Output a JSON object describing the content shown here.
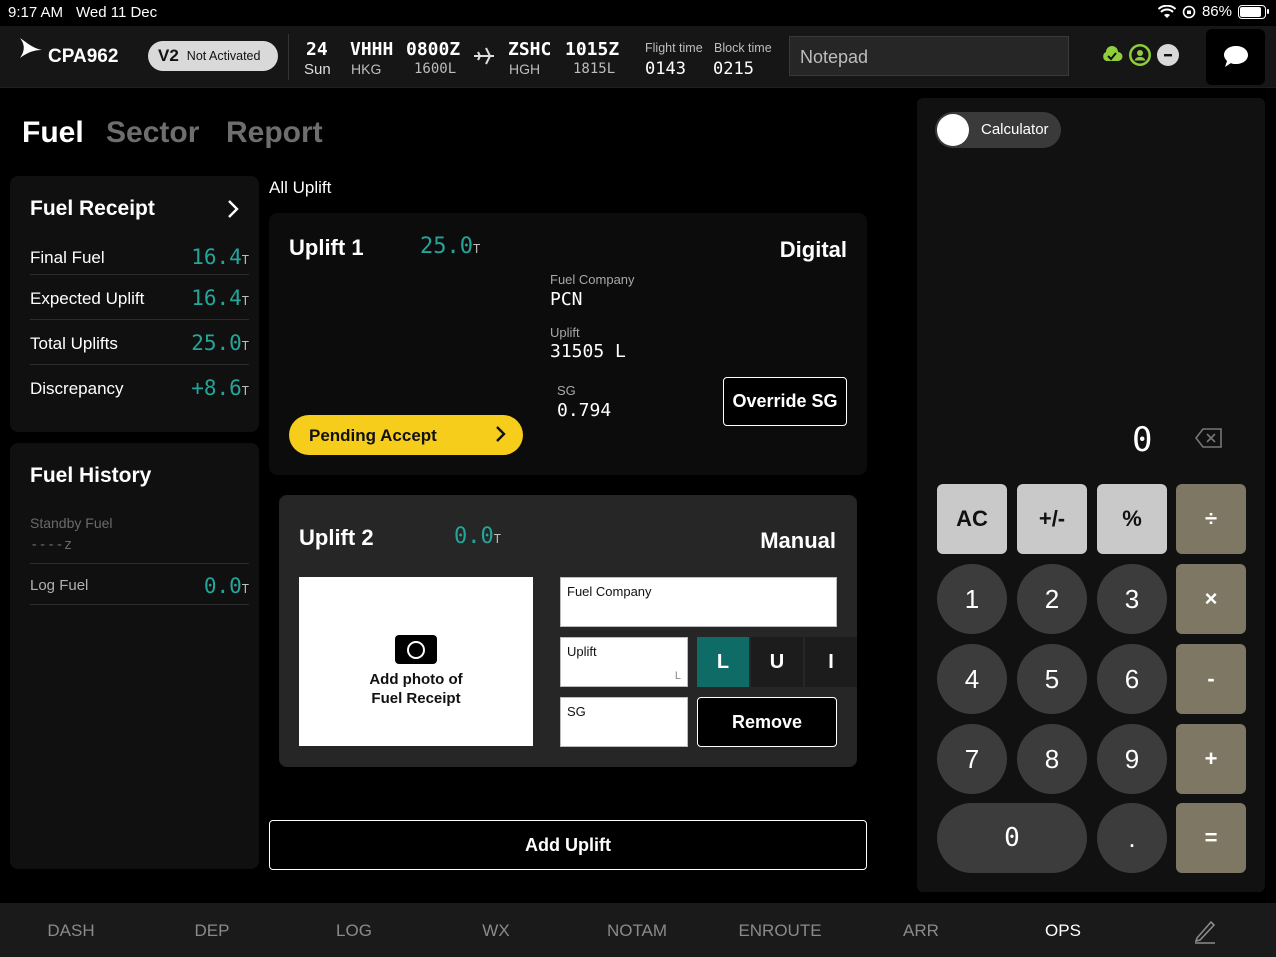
{
  "status_bar": {
    "time": "9:17 AM",
    "date": "Wed 11 Dec",
    "battery": "86%",
    "battery_level": 0.86
  },
  "header": {
    "callsign": "CPA962",
    "version": "V2",
    "version_status": "Not Activated",
    "day_num": "24",
    "day_name": "Sun",
    "dep_icao": "VHHH",
    "dep_iata": "HKG",
    "dep_time_z": "0800Z",
    "dep_time_l": "1600L",
    "arr_icao": "ZSHC",
    "arr_iata": "HGH",
    "arr_time_z": "1015Z",
    "arr_time_l": "1815L",
    "flight_time_label": "Flight time",
    "flight_time": "0143",
    "block_time_label": "Block time",
    "block_time": "0215",
    "notepad_placeholder": "Notepad",
    "icons": [
      "cloud-check-icon",
      "user-circle-icon",
      "minus-circle-icon",
      "chat-bubble-icon"
    ]
  },
  "tabs": [
    "Fuel",
    "Sector",
    "Report"
  ],
  "fuel_receipt": {
    "title": "Fuel Receipt",
    "rows": [
      {
        "label": "Final Fuel",
        "value": "16.4",
        "unit": "T"
      },
      {
        "label": "Expected Uplift",
        "value": "16.4",
        "unit": "T"
      },
      {
        "label": "Total Uplifts",
        "value": "25.0",
        "unit": "T"
      },
      {
        "label": "Discrepancy",
        "value": "+8.6",
        "unit": "T"
      }
    ]
  },
  "fuel_history": {
    "title": "Fuel History",
    "standby_label": "Standby Fuel",
    "standby_value": "----z",
    "log_label": "Log Fuel",
    "log_value": "0.0",
    "log_unit": "T"
  },
  "all_uplift_label": "All Uplift",
  "uplift1": {
    "title": "Uplift 1",
    "value": "25.0",
    "unit": "T",
    "mode": "Digital",
    "fuel_company_label": "Fuel Company",
    "fuel_company": "PCN",
    "uplift_label": "Uplift",
    "uplift": "31505 L",
    "sg_label": "SG",
    "sg": "0.794",
    "override_label": "Override SG",
    "pending_label": "Pending Accept"
  },
  "uplift2": {
    "title": "Uplift 2",
    "value": "0.0",
    "unit": "T",
    "mode": "Manual",
    "photo_label_1": "Add photo of",
    "photo_label_2": "Fuel Receipt",
    "fuel_company_placeholder": "Fuel Company",
    "uplift_placeholder": "Uplift",
    "uplift_unit": "L",
    "sg_placeholder": "SG",
    "units": [
      "L",
      "U",
      "I"
    ],
    "selected_unit": "L",
    "remove_label": "Remove"
  },
  "add_uplift_label": "Add Uplift",
  "calculator": {
    "toggle_label": "Calculator",
    "display": "0",
    "keys": {
      "ac": "AC",
      "sign": "+/-",
      "pct": "%",
      "div": "÷",
      "k1": "1",
      "k2": "2",
      "k3": "3",
      "mul": "×",
      "k4": "4",
      "k5": "5",
      "k6": "6",
      "sub": "-",
      "k7": "7",
      "k8": "8",
      "k9": "9",
      "add": "+",
      "k0": "0",
      "dot": ".",
      "eq": "="
    }
  },
  "bottom_nav": [
    "DASH",
    "DEP",
    "LOG",
    "WX",
    "NOTAM",
    "ENROUTE",
    "ARR",
    "OPS"
  ],
  "active_nav": "OPS",
  "colors": {
    "teal": "#25a59a",
    "yellow": "#f6cd1a",
    "op_key": "#7e7764",
    "selected_unit": "#0f6b66"
  }
}
